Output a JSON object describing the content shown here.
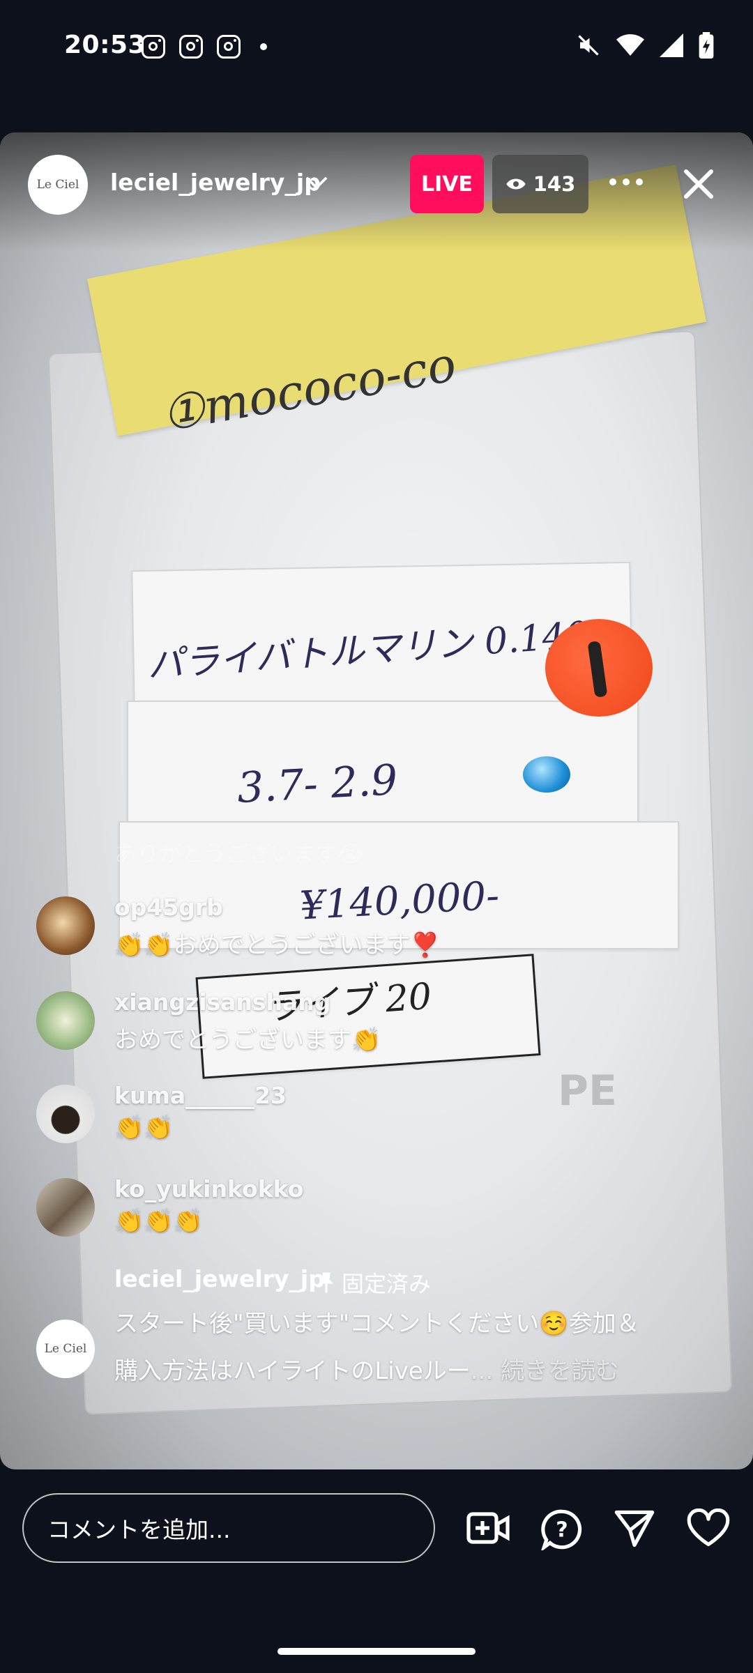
{
  "status_bar": {
    "time": "20:53"
  },
  "live": {
    "host_name": "leciel_jewelry_jp",
    "host_logo_text": "Le Ciel",
    "badge": "LIVE",
    "viewer_count": "143"
  },
  "video": {
    "sticky_note": "①mococo-co",
    "label_line1": "パライバトルマリン 0.140",
    "label_line2": "3.7- 2.9",
    "label_line3": "¥140,000-",
    "label_line4": "ライブ 20",
    "sticker_number": "1",
    "recycle_mark": "PE"
  },
  "comments": [
    {
      "user": "op45grb",
      "text": "👏👏おめでとうございます❣️"
    },
    {
      "user": "xiangzisanshang",
      "text": "おめでとうございます👏"
    },
    {
      "user": "kuma______23",
      "text": "👏👏"
    },
    {
      "user": "ko_yukinkokko",
      "text": "👏👏👏"
    }
  ],
  "faded_comment": "ありがとうございます😭",
  "pinned": {
    "user": "leciel_jewelry_jp",
    "tag": "固定済み",
    "text": "スタート後\"買います\"コメントください☺️参加＆購入方法はハイライトのLiveルー",
    "read_more": "... 続きを読む"
  },
  "bottom_bar": {
    "comment_placeholder": "コメントを追加..."
  }
}
